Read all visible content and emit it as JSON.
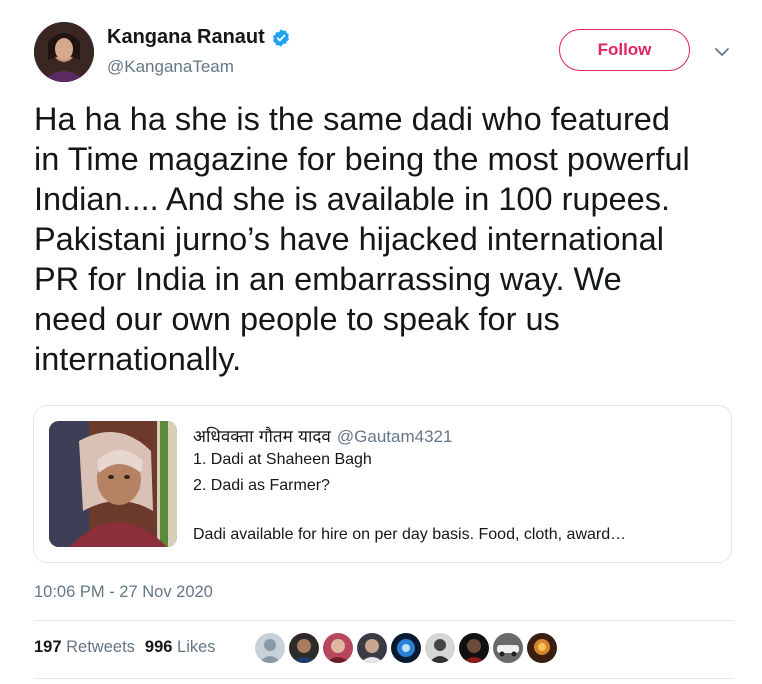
{
  "author": {
    "name": "Kangana Ranaut",
    "handle": "@KanganaTeam",
    "verified_icon": "verified-badge-icon"
  },
  "follow_label": "Follow",
  "tweet": {
    "text": "Ha ha ha she is the same dadi who featured\nin Time magazine for being the most powerful\nIndian.... And she is available in 100 rupees.\nPakistani jurno’s have hijacked international\nPR for India in an embarrassing way. We\nneed our own people to speak for us\ninternationally."
  },
  "quoted": {
    "name": "अधिवक्ता गौतम यादव",
    "handle": "@Gautam4321",
    "line1": "1. Dadi at Shaheen Bagh",
    "line2": "2. Dadi as Farmer?",
    "line3": "Dadi available for hire on per day basis. Food, cloth, award…"
  },
  "timestamp": "10:06 PM - 27 Nov 2020",
  "stats": {
    "retweets_count": "197",
    "retweets_label": "Retweets",
    "likes_count": "996",
    "likes_label": "Likes"
  },
  "colors": {
    "accent": "#e0245e",
    "verified": "#1da1f2",
    "muted": "#657786"
  }
}
